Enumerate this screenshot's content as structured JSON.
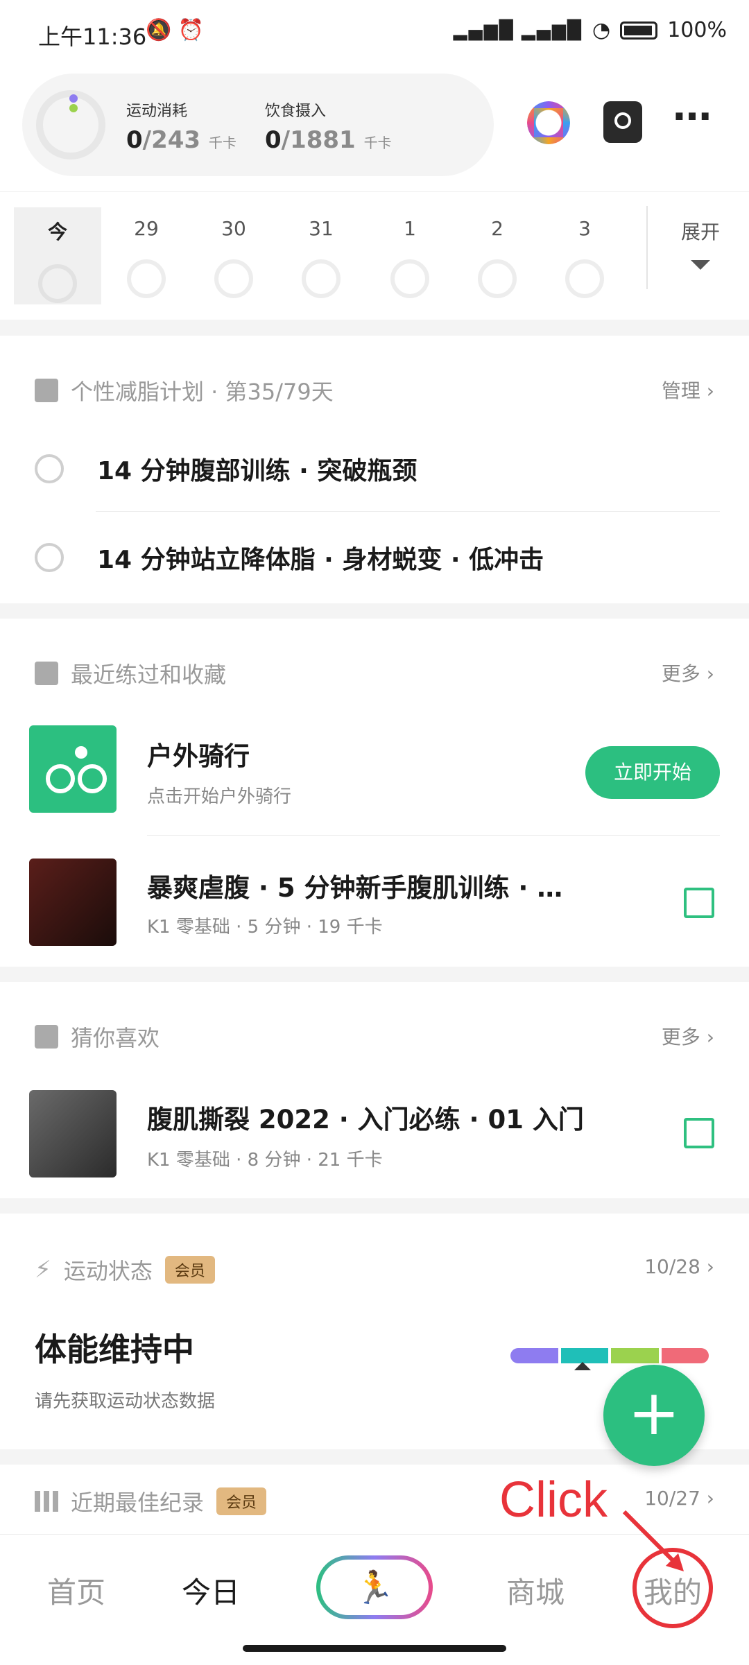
{
  "status_bar": {
    "time": "上午11:36",
    "battery": "100%",
    "signal": "HD ⋮ HD ⋮ ᯤ"
  },
  "header": {
    "exercise_label": "运动消耗",
    "exercise_value": "0",
    "exercise_total": "/243",
    "food_label": "饮食摄入",
    "food_value": "0",
    "food_total": "/1881",
    "unit": "千卡",
    "more_icon": "⋯"
  },
  "calendar": {
    "days": [
      "今",
      "29",
      "30",
      "31",
      "1",
      "2",
      "3"
    ],
    "expand_label": "展开"
  },
  "plan": {
    "title": "个性减脂计划 · 第35/79天",
    "manage": "管理",
    "tasks": [
      "14 分钟腹部训练 · 突破瓶颈",
      "14 分钟站立降体脂 · 身材蜕变 · 低冲击"
    ]
  },
  "recent": {
    "title": "最近练过和收藏",
    "more": "更多",
    "items": [
      {
        "title": "户外骑行",
        "sub": "点击开始户外骑行",
        "action": "立即开始"
      },
      {
        "title": "暴爽虐腹 · 5 分钟新手腹肌训练 · …",
        "sub": "K1 零基础 · 5 分钟 · 19 千卡"
      }
    ]
  },
  "guess": {
    "title": "猜你喜欢",
    "more": "更多",
    "items": [
      {
        "title": "腹肌撕裂 2022 · 入门必练 · 01 入门",
        "sub": "K1 零基础 · 8 分钟 · 21 千卡"
      }
    ]
  },
  "status_card": {
    "title": "运动状态",
    "badge": "会员",
    "date": "10/28",
    "heading": "体能维持中",
    "sub": "请先获取运动状态数据"
  },
  "records": {
    "title": "近期最佳纪录",
    "badge": "会员",
    "date": "10/27"
  },
  "fab": "+",
  "bottom_nav": [
    "首页",
    "今日",
    "商城",
    "我的"
  ],
  "annotation": {
    "text": "Click",
    "color": "#e8333a"
  },
  "colors": {
    "accent": "#2cbf80",
    "status_bar_colors": [
      "#8e7cf0",
      "#1fbfb8",
      "#9bd24e",
      "#f06a78"
    ]
  }
}
